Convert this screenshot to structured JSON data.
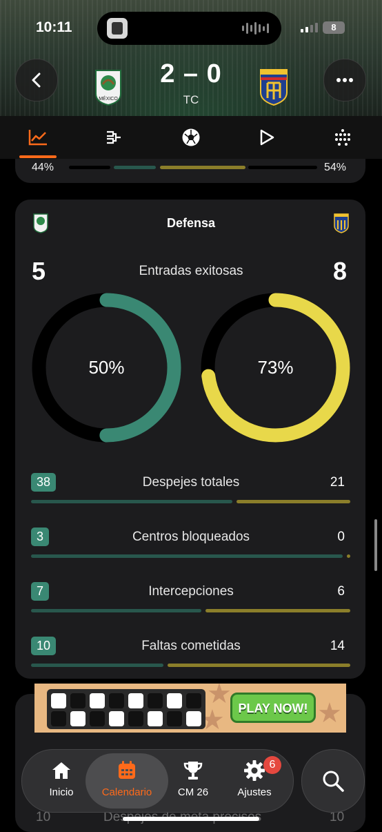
{
  "status_bar": {
    "time": "10:11",
    "battery": "8"
  },
  "match": {
    "score": "2 – 0",
    "status": "TC",
    "home_team_icon": "mexico-badge-icon",
    "away_team_icon": "ecuador-badge-icon",
    "home_badge_text": "MÉXICO"
  },
  "tabs": [
    {
      "icon": "stats-chart-icon",
      "active": true
    },
    {
      "icon": "bracket-icon",
      "active": false
    },
    {
      "icon": "soccer-ball-icon",
      "active": false
    },
    {
      "icon": "play-icon",
      "active": false
    },
    {
      "icon": "lineup-grid-icon",
      "active": false
    }
  ],
  "possession": {
    "home": "44%",
    "away": "54%"
  },
  "defense": {
    "title": "Defensa",
    "tackles": {
      "label": "Entradas exitosas",
      "home_value": "5",
      "away_value": "8",
      "home_pct": "50%",
      "away_pct": "73%",
      "home_fraction": 0.5,
      "away_fraction": 0.73
    },
    "stats": [
      {
        "label": "Despejes totales",
        "home": "38",
        "away": "21",
        "home_share": 0.64
      },
      {
        "label": "Centros bloqueados",
        "home": "3",
        "away": "0",
        "home_share": 0.99
      },
      {
        "label": "Intercepciones",
        "home": "7",
        "away": "6",
        "home_share": 0.54
      },
      {
        "label": "Faltas cometidas",
        "home": "10",
        "away": "14",
        "home_share": 0.42
      }
    ]
  },
  "ad": {
    "button": "PLAY NOW!"
  },
  "behind_nav": {
    "left_value": "10",
    "label": "Despejes de meta precisos",
    "right_value": "10"
  },
  "nav": {
    "items": [
      {
        "label": "Inicio",
        "icon": "home-icon"
      },
      {
        "label": "Calendario",
        "icon": "calendar-icon"
      },
      {
        "label": "CM 26",
        "icon": "trophy-icon"
      },
      {
        "label": "Ajustes",
        "icon": "gear-icon"
      }
    ],
    "settings_badge": "6",
    "search_icon": "search-icon"
  },
  "colors": {
    "accent": "#ff6a1a",
    "home": "#3a8873",
    "away": "#e8d84a",
    "card": "#1c1c1e"
  }
}
